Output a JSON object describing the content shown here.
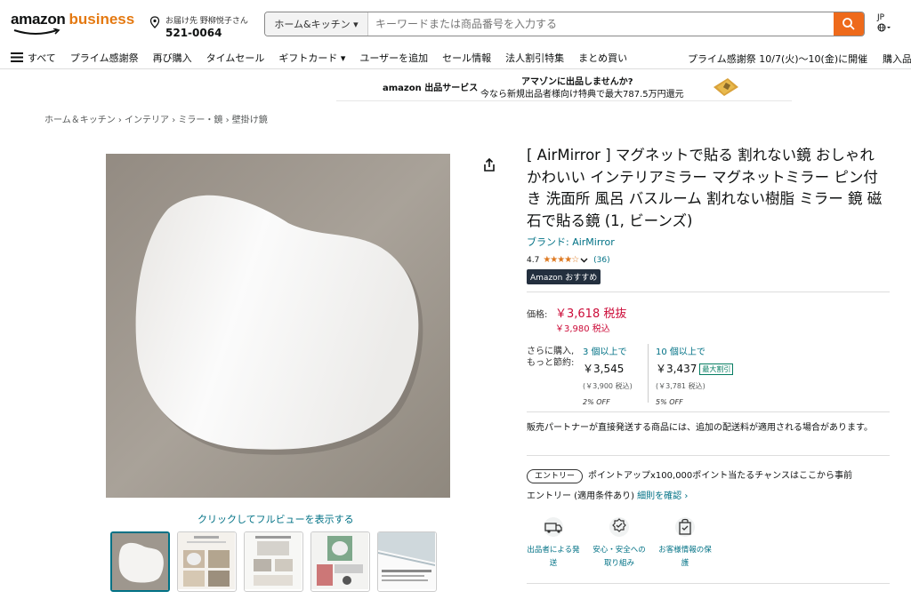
{
  "header": {
    "logo_main": "amazon",
    "logo_sub": "business",
    "location_label": "お届け先 野柳悦子さん",
    "location_zip": "521-0064",
    "search_category": "ホーム&キッチン ▾",
    "search_placeholder": "キーワードまたは商品番号を入力する",
    "lang_code": "JP"
  },
  "nav": {
    "items": [
      "すべて",
      "プライム感謝祭",
      "再び購入",
      "タイムセール",
      "ギフトカード ▾",
      "ユーザーを追加",
      "セール情報",
      "法人割引特集",
      "まとめ買い"
    ],
    "promo": "プライム感謝祭 10/7(火)〜10(金)に開催",
    "last": "購入品"
  },
  "banner": {
    "brand": "amazon 出品サービス",
    "headline": "アマゾンに出品しませんか?",
    "subline": "今なら新規出品者様向け特典で最大787.5万円還元"
  },
  "breadcrumb": "ホーム＆キッチン › インテリア › ミラー・鏡 › 壁掛け鏡",
  "gallery": {
    "fullview_label": "クリックしてフルビューを表示する"
  },
  "product": {
    "title": "[ AirMirror ] マグネットで貼る 割れない鏡 おしゃれ かわいい インテリアミラー マグネットミラー ピン付き 洗面所 風呂 バスルーム 割れない樹脂 ミラー 鏡 磁石で貼る鏡 (1, ビーンズ)",
    "brand": "ブランド: AirMirror",
    "rating": "4.7",
    "rating_count": "(36)",
    "badge": "Amazon おすすめ",
    "price_label": "価格:",
    "price": "￥3,618 税抜",
    "price_incl": "￥3,980 税込",
    "tier_lead": "さらに購入, もっと節約:",
    "tiers": [
      {
        "qty": "3 個以上で",
        "price": "￥3,545",
        "tax": "(￥3,900 税込)",
        "off": "2% OFF"
      },
      {
        "qty": "10 個以上で",
        "price": "￥3,437",
        "tax": "(￥3,781 税込)",
        "off": "5% OFF",
        "badge": "最大割引"
      }
    ],
    "note": "販売パートナーが直接発送する商品には、追加の配送料が適用される場合があります。",
    "entry_pill": "エントリー",
    "entry_text1": "ポイントアップx100,000ポイント当たるチャンスはここから事前",
    "entry_text2": "エントリー (適用条件あり)",
    "entry_link": "細則を確認 ›",
    "features": [
      {
        "label": "出品者による発送",
        "icon": "truck-icon"
      },
      {
        "label": "安心・安全への取り組み",
        "icon": "shield-badge-icon"
      },
      {
        "label": "お客様情報の保護",
        "icon": "lock-bag-icon"
      }
    ]
  },
  "colors": {
    "accent": "#ee6a1b",
    "link": "#007185",
    "price": "#cc0c39"
  }
}
